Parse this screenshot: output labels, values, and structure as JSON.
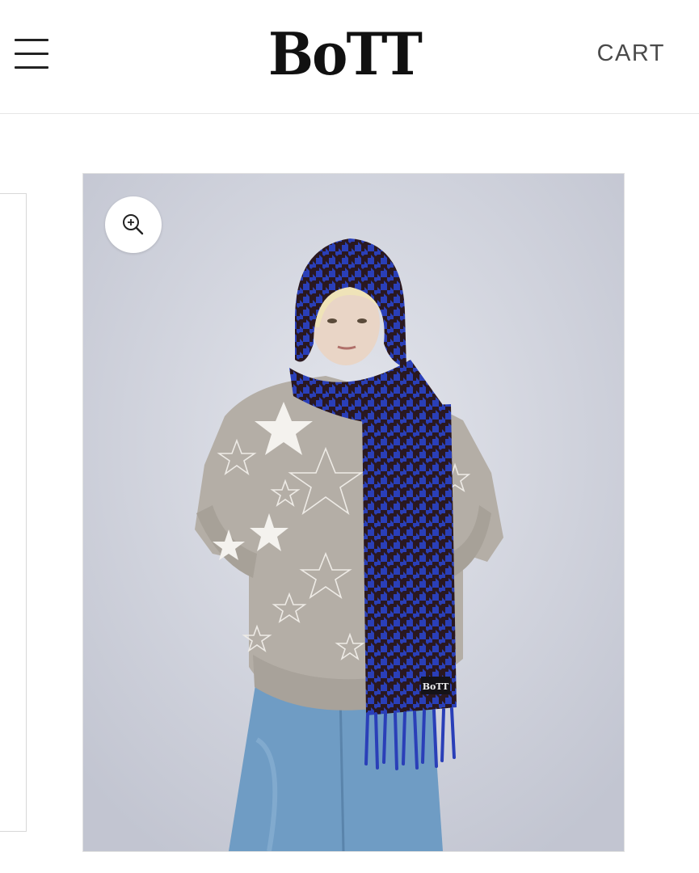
{
  "header": {
    "menu_icon": "hamburger-menu-icon",
    "logo_text": "BoTT",
    "cart_label": "CART"
  },
  "product": {
    "zoom_icon": "zoom-in-icon",
    "scarf_label": "BoTT"
  },
  "colors": {
    "scarf_blue": "#2a3fb8",
    "scarf_dark": "#2a1820",
    "sweater_gray": "#b4aea6",
    "jeans_blue": "#6f9cc4",
    "backdrop": "#d3d6e0"
  }
}
